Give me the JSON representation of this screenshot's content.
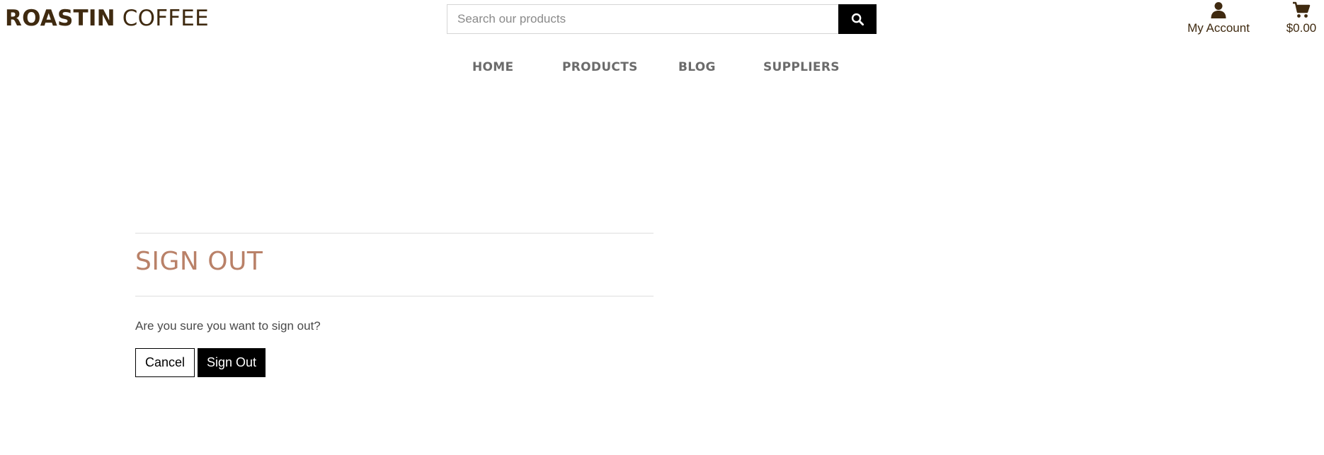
{
  "header": {
    "logo": {
      "bold": "ROASTIN",
      "light": "COFFEE"
    },
    "search": {
      "placeholder": "Search our products",
      "value": "",
      "button_icon": "search-icon"
    },
    "account": {
      "label": "My Account",
      "icon": "user-icon"
    },
    "cart": {
      "total": "$0.00",
      "icon": "cart-icon"
    }
  },
  "nav": {
    "items": [
      {
        "label": "HOME"
      },
      {
        "label": "PRODUCTS"
      },
      {
        "label": "BLOG"
      },
      {
        "label": "SUPPLIERS"
      }
    ]
  },
  "main": {
    "title": "SIGN OUT",
    "question": "Are you sure you want to sign out?",
    "cancel_label": "Cancel",
    "signout_label": "Sign Out"
  },
  "colors": {
    "brand": "#3f2a10",
    "title": "#b98168",
    "nav_text": "#6b6b6b",
    "button_primary": "#000000"
  }
}
